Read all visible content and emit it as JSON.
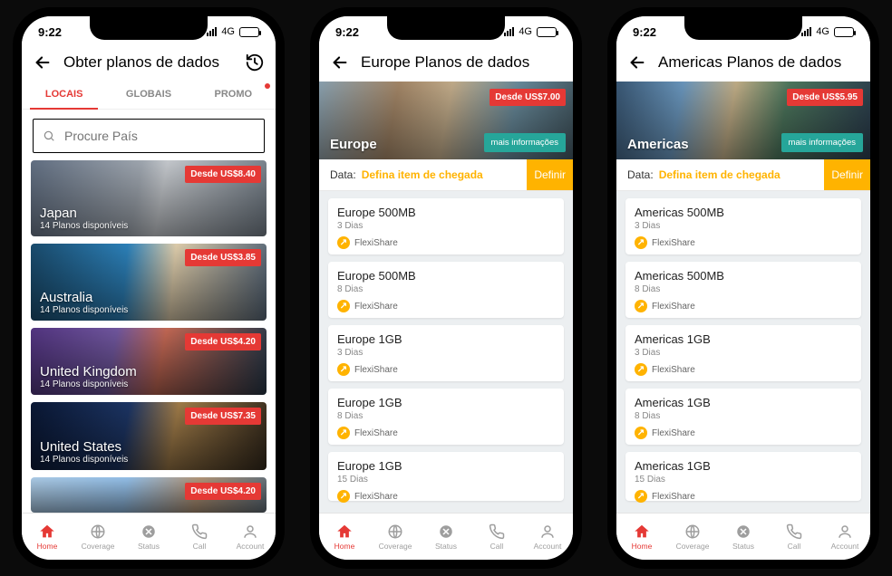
{
  "status": {
    "time": "9:22",
    "network": "4G"
  },
  "nav": {
    "items": [
      {
        "label": "Home",
        "icon": "home"
      },
      {
        "label": "Coverage",
        "icon": "coverage"
      },
      {
        "label": "Status",
        "icon": "status"
      },
      {
        "label": "Call",
        "icon": "call"
      },
      {
        "label": "Account",
        "icon": "account"
      }
    ],
    "active_index": 0
  },
  "screen1": {
    "title": "Obter planos de dados",
    "tabs": [
      "LOCAIS",
      "GLOBAIS",
      "PROMO"
    ],
    "active_tab": 0,
    "promo_has_dot": true,
    "search_placeholder": "Procure País",
    "countries": [
      {
        "name": "Japan",
        "plans": "14 Planos disponíveis",
        "price": "Desde US$8.40",
        "bg": "bg-japan"
      },
      {
        "name": "Australia",
        "plans": "14 Planos disponíveis",
        "price": "Desde US$3.85",
        "bg": "bg-australia"
      },
      {
        "name": "United Kingdom",
        "plans": "14 Planos disponíveis",
        "price": "Desde US$4.20",
        "bg": "bg-uk"
      },
      {
        "name": "United States",
        "plans": "14 Planos disponíveis",
        "price": "Desde US$7.35",
        "bg": "bg-us"
      },
      {
        "name": "",
        "plans": "",
        "price": "Desde US$4.20",
        "bg": "bg-generic"
      }
    ]
  },
  "screen2": {
    "title": "Europe Planos de dados",
    "hero_name": "Europe",
    "hero_price": "Desde US$7.00",
    "more_info": "mais informações",
    "date_label": "Data:",
    "date_value": "Defina item de chegada",
    "define_btn": "Definir",
    "flexi_label": "FlexiShare",
    "plans": [
      {
        "title": "Europe 500MB",
        "days": "3 Dias"
      },
      {
        "title": "Europe 500MB",
        "days": "8 Dias"
      },
      {
        "title": "Europe 1GB",
        "days": "3 Dias"
      },
      {
        "title": "Europe 1GB",
        "days": "8 Dias"
      },
      {
        "title": "Europe 1GB",
        "days": "15 Dias"
      }
    ]
  },
  "screen3": {
    "title": "Americas Planos de dados",
    "hero_name": "Americas",
    "hero_price": "Desde US$5.95",
    "more_info": "mais informações",
    "date_label": "Data:",
    "date_value": "Defina item de chegada",
    "define_btn": "Definir",
    "flexi_label": "FlexiShare",
    "plans": [
      {
        "title": "Americas 500MB",
        "days": "3 Dias"
      },
      {
        "title": "Americas 500MB",
        "days": "8 Dias"
      },
      {
        "title": "Americas 1GB",
        "days": "3 Dias"
      },
      {
        "title": "Americas 1GB",
        "days": "8 Dias"
      },
      {
        "title": "Americas 1GB",
        "days": "15 Dias"
      }
    ]
  }
}
